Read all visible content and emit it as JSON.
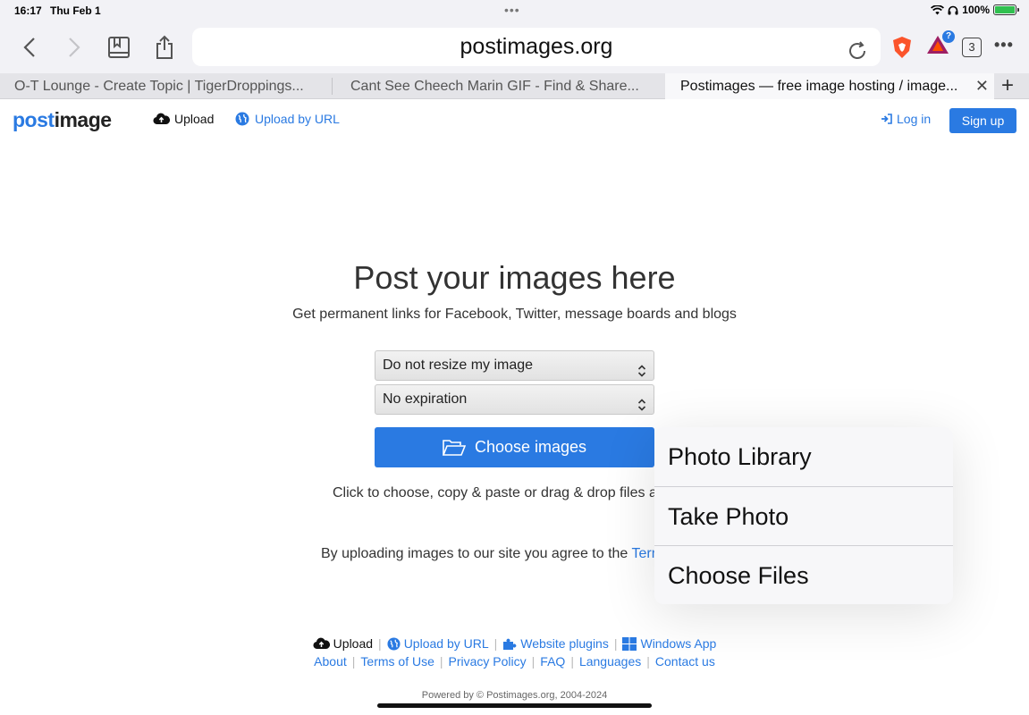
{
  "status": {
    "time": "16:17",
    "date": "Thu Feb 1",
    "battery": "100%"
  },
  "browser": {
    "url": "postimages.org",
    "tab_count": "3",
    "notification_badge": "?",
    "tabs": [
      {
        "title": "O-T Lounge - Create Topic | TigerDroppings..."
      },
      {
        "title": "Cant See Cheech Marin GIF - Find & Share..."
      },
      {
        "title": "Postimages — free image hosting / image..."
      }
    ]
  },
  "site": {
    "logo_post": "post",
    "logo_image": "image",
    "nav_upload": "Upload",
    "nav_upload_url": "Upload by URL",
    "login": "Log in",
    "signup": "Sign up"
  },
  "main": {
    "title": "Post your images here",
    "subtitle": "Get permanent links for Facebook, Twitter, message boards and blogs",
    "resize_select": "Do not resize my image",
    "expiration_select": "No expiration",
    "choose_button": "Choose images",
    "hint": "Click to choose, copy & paste or drag & drop files any",
    "terms_prefix": "By uploading images to our site you agree to the ",
    "terms_link": "Term"
  },
  "popover": {
    "items": [
      "Photo Library",
      "Take Photo",
      "Choose Files"
    ]
  },
  "footer": {
    "upload": "Upload",
    "upload_url": "Upload by URL",
    "plugins": "Website plugins",
    "windows": "Windows App",
    "links": [
      "About",
      "Terms of Use",
      "Privacy Policy",
      "FAQ",
      "Languages",
      "Contact us"
    ],
    "powered": "Powered by © Postimages.org, 2004-2024"
  },
  "colors": {
    "accent": "#2a7ae2",
    "battery": "#30c04f",
    "brave": "#fb542b"
  }
}
